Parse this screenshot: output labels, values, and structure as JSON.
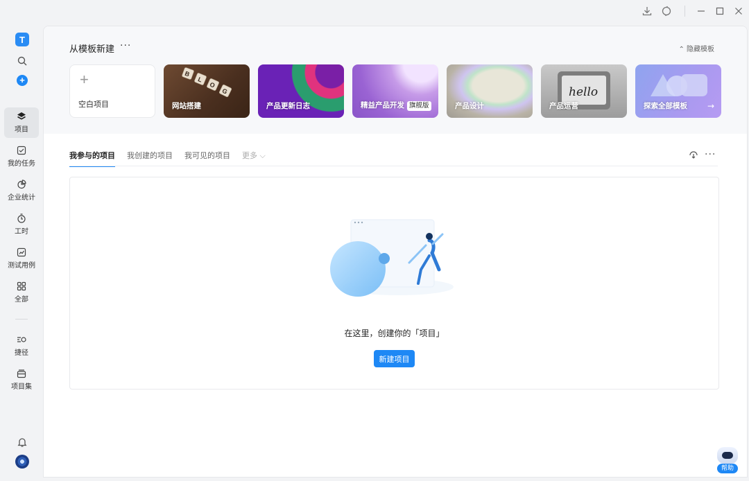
{
  "titlebar": {
    "icons": [
      "download-icon",
      "sync-icon",
      "minimize-icon",
      "maximize-icon",
      "close-icon"
    ]
  },
  "sidebar": {
    "logo": "T",
    "items": [
      {
        "label": "项目",
        "icon": "layers-icon",
        "active": true
      },
      {
        "label": "我的任务",
        "icon": "checkbox-icon"
      },
      {
        "label": "企业统计",
        "icon": "pie-chart-icon"
      },
      {
        "label": "工时",
        "icon": "stopwatch-icon"
      },
      {
        "label": "测试用例",
        "icon": "trend-chart-icon"
      },
      {
        "label": "全部",
        "icon": "grid-icon"
      },
      {
        "label": "捷径",
        "icon": "shortcut-icon"
      },
      {
        "label": "项目集",
        "icon": "folder-set-icon"
      }
    ]
  },
  "templates": {
    "title": "从模板新建",
    "more": "···",
    "hide_label": "⌃ 隐藏模板",
    "cards": [
      {
        "label": "空白项目"
      },
      {
        "label": "网站搭建"
      },
      {
        "label": "产品更新日志"
      },
      {
        "label": "精益产品开发",
        "badge": "旗舰版"
      },
      {
        "label": "产品设计"
      },
      {
        "label": "产品运营"
      },
      {
        "label": "探索全部模板",
        "arrow": "→"
      }
    ]
  },
  "tabs": {
    "items": [
      {
        "label": "我参与的项目",
        "active": true
      },
      {
        "label": "我创建的项目"
      },
      {
        "label": "我可见的项目"
      },
      {
        "label": "更多 ⌵"
      }
    ]
  },
  "empty_state": {
    "text": "在这里，创建你的「项目」",
    "button": "新建项目"
  },
  "help": {
    "label": "帮助"
  },
  "colors": {
    "accent": "#1e88f5",
    "background": "#f2f3f5",
    "panel": "#ffffff"
  }
}
